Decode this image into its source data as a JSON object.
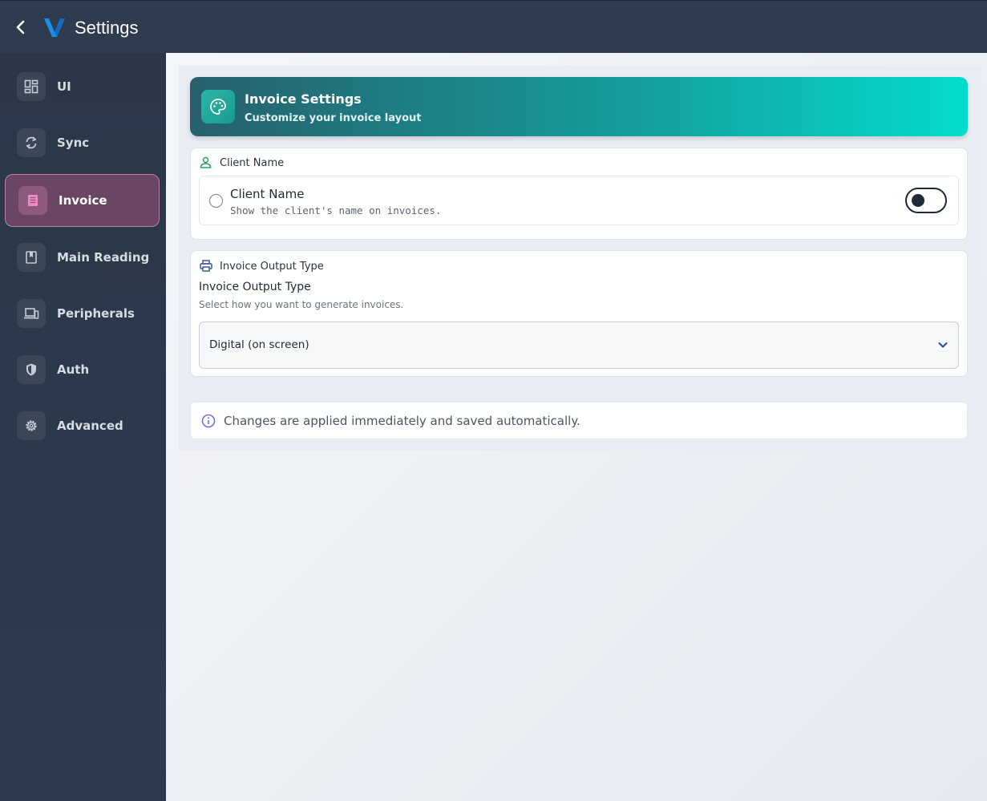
{
  "app": {
    "title": "Settings"
  },
  "sidebar": {
    "items": [
      {
        "label": "UI",
        "icon": "dashboard-icon"
      },
      {
        "label": "Sync",
        "icon": "sync-icon"
      },
      {
        "label": "Invoice",
        "icon": "invoice-icon",
        "active": true
      },
      {
        "label": "Main Reading",
        "icon": "book-icon"
      },
      {
        "label": "Peripherals",
        "icon": "devices-icon"
      },
      {
        "label": "Auth",
        "icon": "shield-icon"
      },
      {
        "label": "Advanced",
        "icon": "gear-icon"
      }
    ]
  },
  "header": {
    "title": "Invoice Settings",
    "subtitle": "Customize your invoice layout",
    "icon": "palette-icon"
  },
  "client_name_section": {
    "label": "Client Name",
    "icon": "person-icon",
    "setting": {
      "title": "Client Name",
      "description": "Show the client's name on invoices.",
      "enabled": false
    }
  },
  "output_section": {
    "label": "Invoice Output Type",
    "icon": "printer-icon",
    "title": "Invoice Output Type",
    "description": "Select how you want to generate invoices.",
    "selected_value": "Digital (on screen)"
  },
  "note": {
    "text": "Changes are applied immediately and saved automatically.",
    "icon": "info-icon"
  },
  "colors": {
    "accent_teal": "#03dccb",
    "active_nav": "#6b4664",
    "sidebar": "#2d3a4d"
  }
}
